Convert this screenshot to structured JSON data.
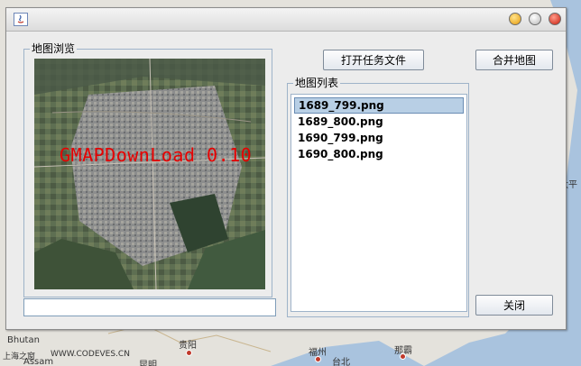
{
  "window": {
    "title": "",
    "controls": [
      "minimize",
      "maximize",
      "close"
    ]
  },
  "preview": {
    "group_label": "地图浏览",
    "overlay_text": "GMAPDownLoad 0.10"
  },
  "progress": {
    "value": 0
  },
  "buttons": {
    "open_task": "打开任务文件",
    "merge_map": "合并地图",
    "close": "关闭"
  },
  "map_list": {
    "group_label": "地图列表",
    "items": [
      "1689_799.png",
      "1689_800.png",
      "1690_799.png",
      "1690_800.png"
    ],
    "selected_index": 0
  },
  "background": {
    "labels": [
      "Bhutan",
      "Assam",
      "贵阳",
      "昆明",
      "福州",
      "台北",
      "那霸",
      "上海之窗",
      "WWW.CODEVES.CN",
      "太平"
    ]
  },
  "colors": {
    "overlay_text": "#e60000",
    "selection": "#b8cfe5",
    "panel_border": "#9eb3c9"
  }
}
